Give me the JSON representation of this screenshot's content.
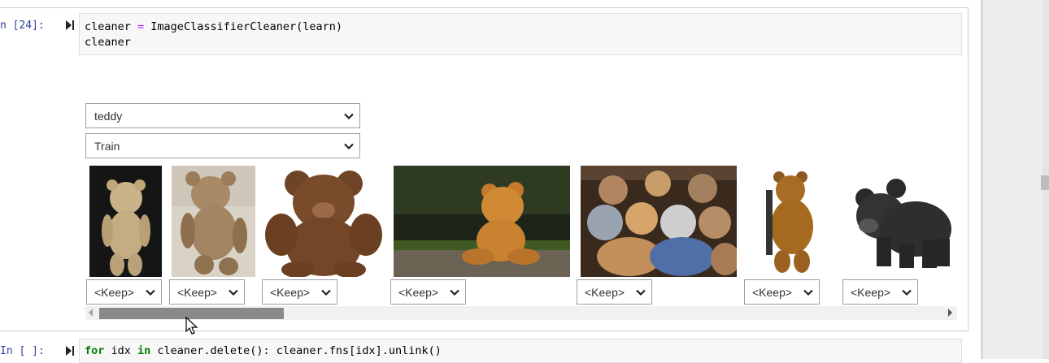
{
  "cell1": {
    "prompt": "n [24]:",
    "code_lines": [
      "cleaner = ImageClassifierCleaner(learn)",
      "cleaner"
    ]
  },
  "widget": {
    "category_select": "teddy",
    "split_select": "Train",
    "images": [
      {
        "alt": "teddy bear image 1",
        "action": "<Keep>"
      },
      {
        "alt": "teddy bear image 2",
        "action": "<Keep>"
      },
      {
        "alt": "teddy bear image 3",
        "action": "<Keep>"
      },
      {
        "alt": "teddy bear image 4",
        "action": "<Keep>"
      },
      {
        "alt": "teddy bear image 5",
        "action": "<Keep>"
      },
      {
        "alt": "teddy bear image 6",
        "action": "<Keep>"
      },
      {
        "alt": "teddy bear image 7",
        "action": "<Keep>"
      }
    ]
  },
  "cell2": {
    "prompt": "In [ ]:",
    "code_parts": [
      "for",
      " idx ",
      "in",
      " cleaner.delete(): cleaner.fns[idx].unlink()"
    ]
  },
  "colors": {
    "prompt": "#303f9f",
    "keyword": "#008000",
    "operator": "#aa22ff"
  },
  "icons": [
    "run-cell-icon",
    "chevron-down-icon",
    "mouse-pointer-icon"
  ]
}
